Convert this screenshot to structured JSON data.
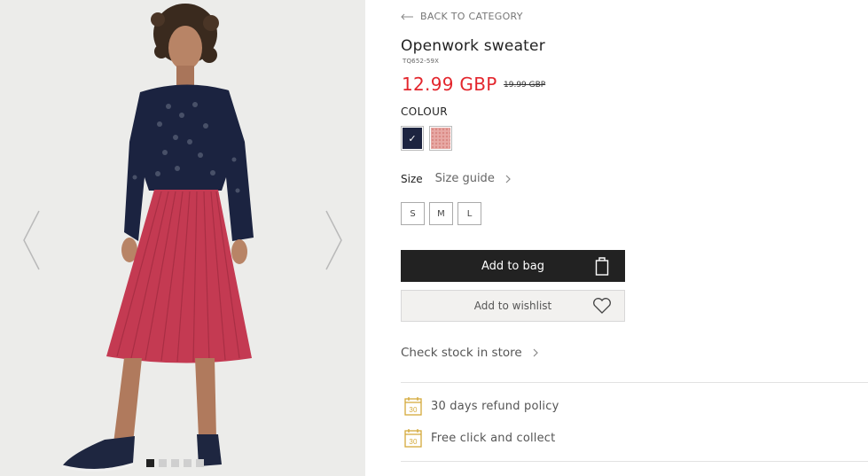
{
  "gallery": {
    "prev_icon": "chevron-left-icon",
    "next_icon": "chevron-right-icon",
    "image_count": 5,
    "active_index": 0
  },
  "product": {
    "back_label": "BACK TO CATEGORY",
    "title": "Openwork sweater",
    "sku": "TQ652-59X",
    "price": "12.99 GBP",
    "old_price": "19.99 GBP",
    "price_color": "#e3262d",
    "colour_label": "COLOUR",
    "swatches": [
      {
        "name": "navy",
        "color": "#1d2440",
        "selected": true,
        "check": "✓"
      },
      {
        "name": "pink",
        "color": "#e7a9a5",
        "selected": false
      }
    ],
    "size_label": "Size",
    "size_guide_label": "Size guide",
    "sizes": [
      "S",
      "M",
      "L"
    ],
    "add_to_bag_label": "Add to bag",
    "bag_icon": "shopping-bag-icon",
    "add_to_wishlist_label": "Add to wishlist",
    "wishlist_icon": "heart-icon",
    "check_stock_label": "Check stock in store"
  },
  "features": [
    {
      "icon": "calendar-30-icon",
      "icon_text": "30",
      "label": "30 days refund policy"
    },
    {
      "icon": "calendar-30-icon",
      "icon_text": "30",
      "label": "Free click and collect"
    }
  ]
}
